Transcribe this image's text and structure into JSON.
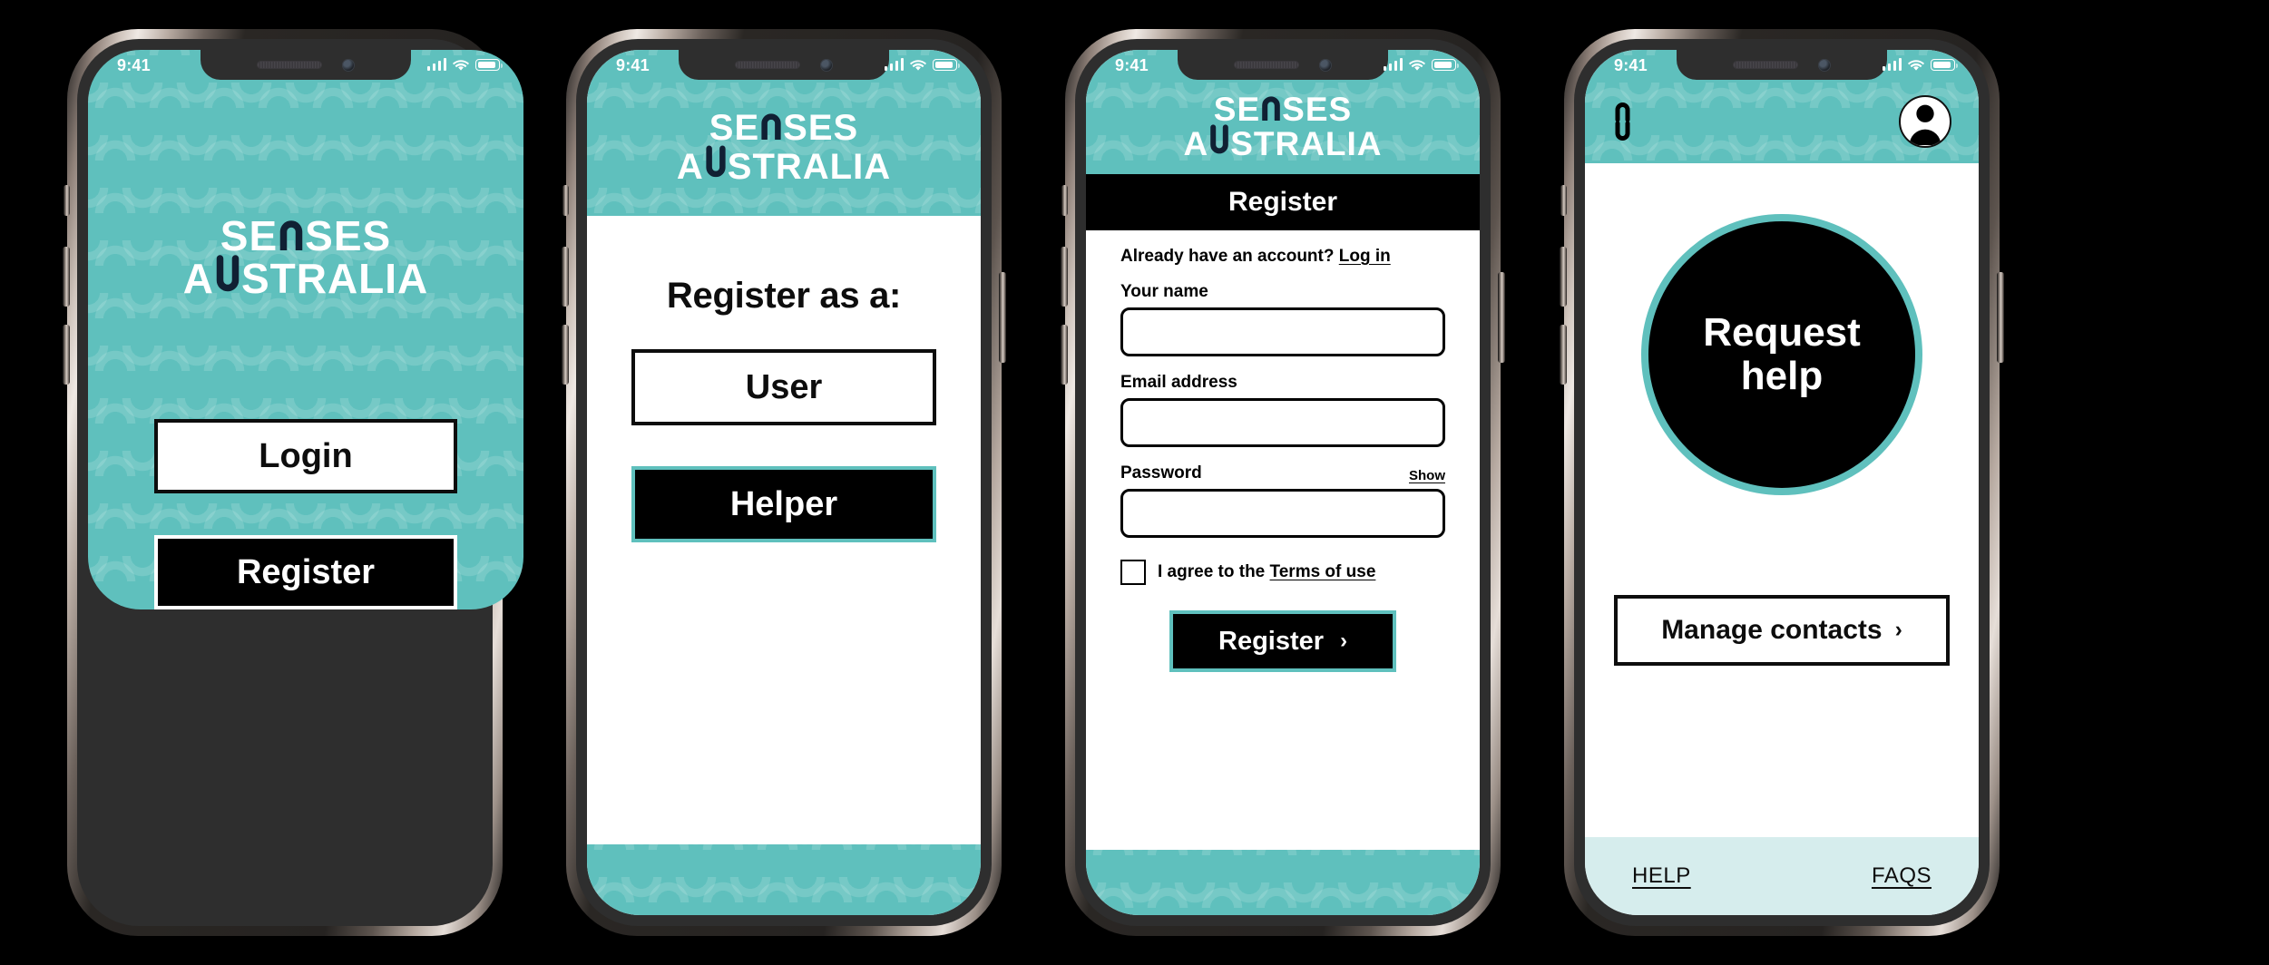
{
  "brand": {
    "name_line1": "SENSES",
    "name_line2": "AUSTRALIA",
    "teal": "#5FC0BD",
    "teal_light": "#D6EDED",
    "navy": "#102033",
    "black": "#000000",
    "white": "#FFFFFF"
  },
  "status_bar": {
    "time": "9:41",
    "signal_icon": "cellular-bars-icon",
    "wifi_icon": "wifi-icon",
    "battery_icon": "battery-icon"
  },
  "screens": [
    {
      "id": "welcome",
      "name": "welcome-screen",
      "background": "teal-pattern",
      "buttons": [
        {
          "label": "Login",
          "style": "white"
        },
        {
          "label": "Register",
          "style": "black-white-border"
        }
      ]
    },
    {
      "id": "register-role",
      "name": "register-role-screen",
      "title": "Register as a:",
      "buttons": [
        {
          "label": "User",
          "style": "white"
        },
        {
          "label": "Helper",
          "style": "black-teal-border"
        }
      ]
    },
    {
      "id": "register-form",
      "name": "register-form-screen",
      "titlebar": "Register",
      "account_prompt": "Already have an account?",
      "account_link": "Log in",
      "fields": [
        {
          "label": "Your name",
          "value": "",
          "placeholder": "",
          "action": ""
        },
        {
          "label": "Email address",
          "value": "",
          "placeholder": "",
          "action": ""
        },
        {
          "label": "Password",
          "value": "",
          "placeholder": "",
          "action": "Show"
        }
      ],
      "agree_prefix": "I agree to the",
      "agree_link": "Terms of use",
      "agree_checked": false,
      "submit_label": "Register",
      "submit_chevron": "›"
    },
    {
      "id": "home",
      "name": "home-screen",
      "logo_mark": "senses-monogram-icon",
      "avatar": "user-avatar-icon",
      "primary_action_line1": "Request",
      "primary_action_line2": "help",
      "secondary_action": "Manage contacts",
      "secondary_chevron": "›",
      "footer_links": [
        "HELP",
        "FAQS"
      ]
    }
  ]
}
